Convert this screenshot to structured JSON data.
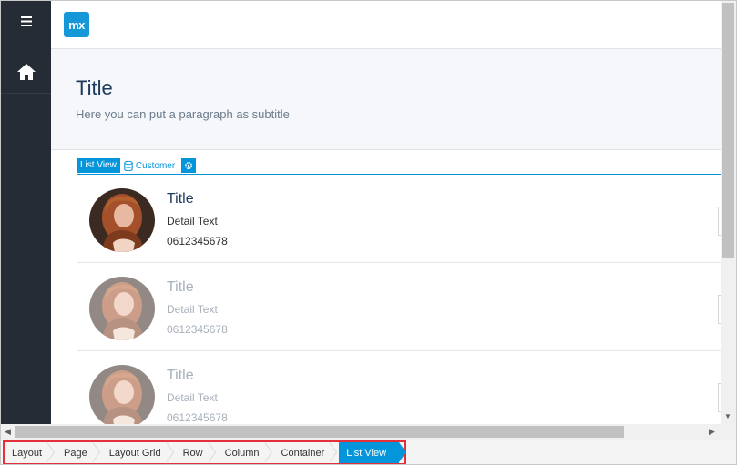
{
  "app": {
    "logo_text": "mx"
  },
  "header": {
    "title": "Title",
    "subtitle": "Here you can put a paragraph as subtitle"
  },
  "listview_tag": {
    "label": "List View",
    "entity": "Customer"
  },
  "list_items": [
    {
      "title": "Title",
      "detail": "Detail Text",
      "phone": "0612345678",
      "faded": false
    },
    {
      "title": "Title",
      "detail": "Detail Text",
      "phone": "0612345678",
      "faded": true
    },
    {
      "title": "Title",
      "detail": "Detail Text",
      "phone": "0612345678",
      "faded": true
    }
  ],
  "breadcrumb": [
    "Layout",
    "Page",
    "Layout Grid",
    "Row",
    "Column",
    "Container",
    "List View"
  ],
  "colors": {
    "sidebar": "#252c36",
    "accent": "#0595db",
    "highlight_border": "#e3303a",
    "title": "#1b3a5c"
  },
  "icons": {
    "menu": "hamburger-icon",
    "home": "home-icon",
    "entity": "database-icon",
    "settings": "gear-icon"
  }
}
